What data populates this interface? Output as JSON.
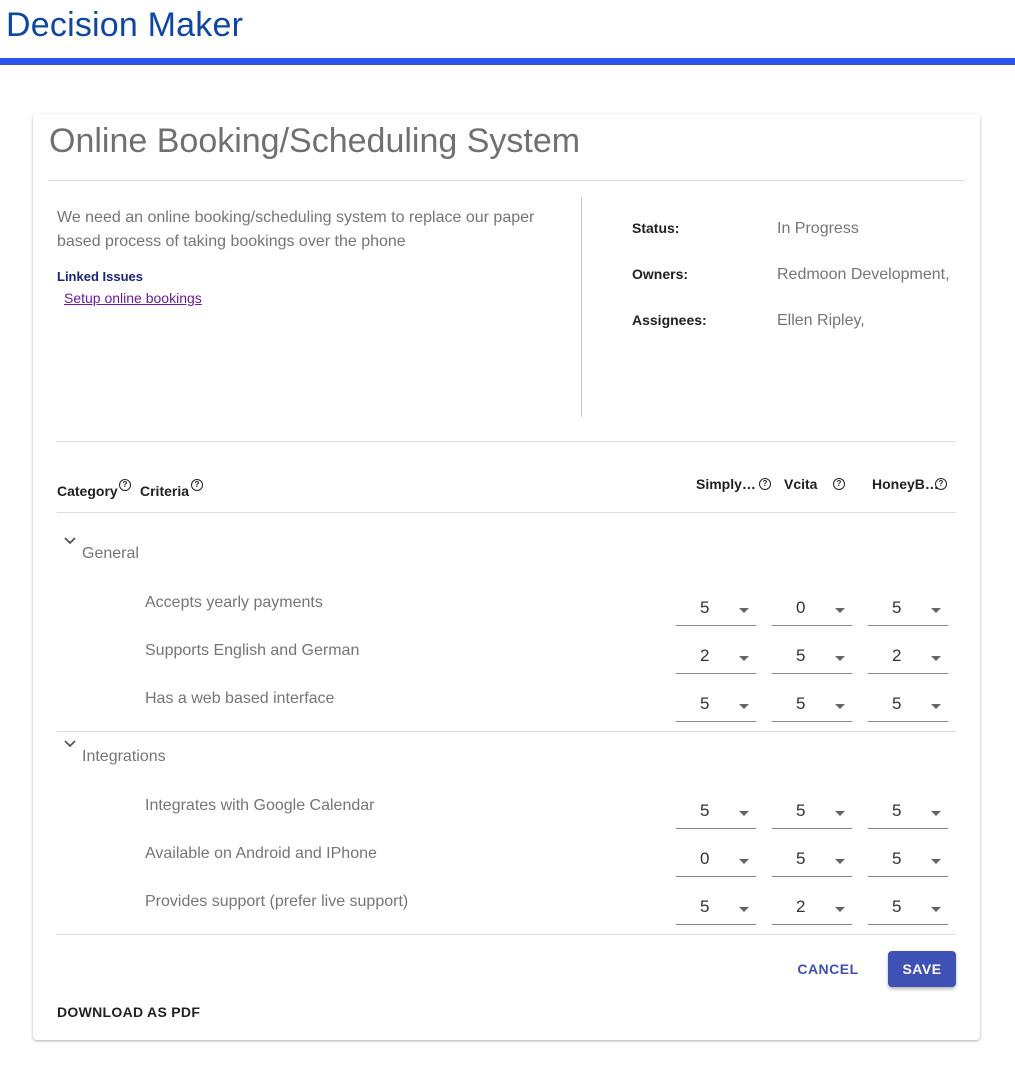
{
  "app": {
    "title": "Decision Maker",
    "accent": "#2f54eb"
  },
  "decision": {
    "title": "Online Booking/Scheduling System",
    "description": "We need an online booking/scheduling system to replace our paper based process of taking bookings over the phone",
    "linked_issues_label": "Linked Issues",
    "linked_issues": [
      "Setup online bookings"
    ]
  },
  "meta": [
    {
      "label": "Status:",
      "value": "In Progress"
    },
    {
      "label": "Owners:",
      "value": "Redmoon Development,"
    },
    {
      "label": "Assignees:",
      "value": "Ellen Ripley,"
    }
  ],
  "table": {
    "category_header": "Category",
    "criteria_header": "Criteria",
    "help_icon": "help-circle-icon",
    "options": [
      "Simply…",
      "Vcita",
      "HoneyB…"
    ],
    "categories": [
      {
        "name": "General",
        "expanded": true,
        "criteria": [
          {
            "name": "Accepts yearly payments",
            "scores": [
              "5",
              "0",
              "5"
            ]
          },
          {
            "name": "Supports English and German",
            "scores": [
              "2",
              "5",
              "2"
            ]
          },
          {
            "name": "Has a web based interface",
            "scores": [
              "5",
              "5",
              "5"
            ]
          }
        ]
      },
      {
        "name": "Integrations",
        "expanded": true,
        "criteria": [
          {
            "name": "Integrates with Google Calendar",
            "scores": [
              "5",
              "5",
              "5"
            ]
          },
          {
            "name": "Available on Android and IPhone",
            "scores": [
              "0",
              "5",
              "5"
            ]
          },
          {
            "name": "Provides support (prefer live support)",
            "scores": [
              "5",
              "2",
              "5"
            ]
          }
        ]
      }
    ]
  },
  "actions": {
    "cancel": "CANCEL",
    "save": "SAVE",
    "download_pdf": "DOWNLOAD AS PDF"
  },
  "colors": {
    "primary": "#3f51b5",
    "title_blue": "#0d47a1",
    "link": "#6a1b9a"
  }
}
